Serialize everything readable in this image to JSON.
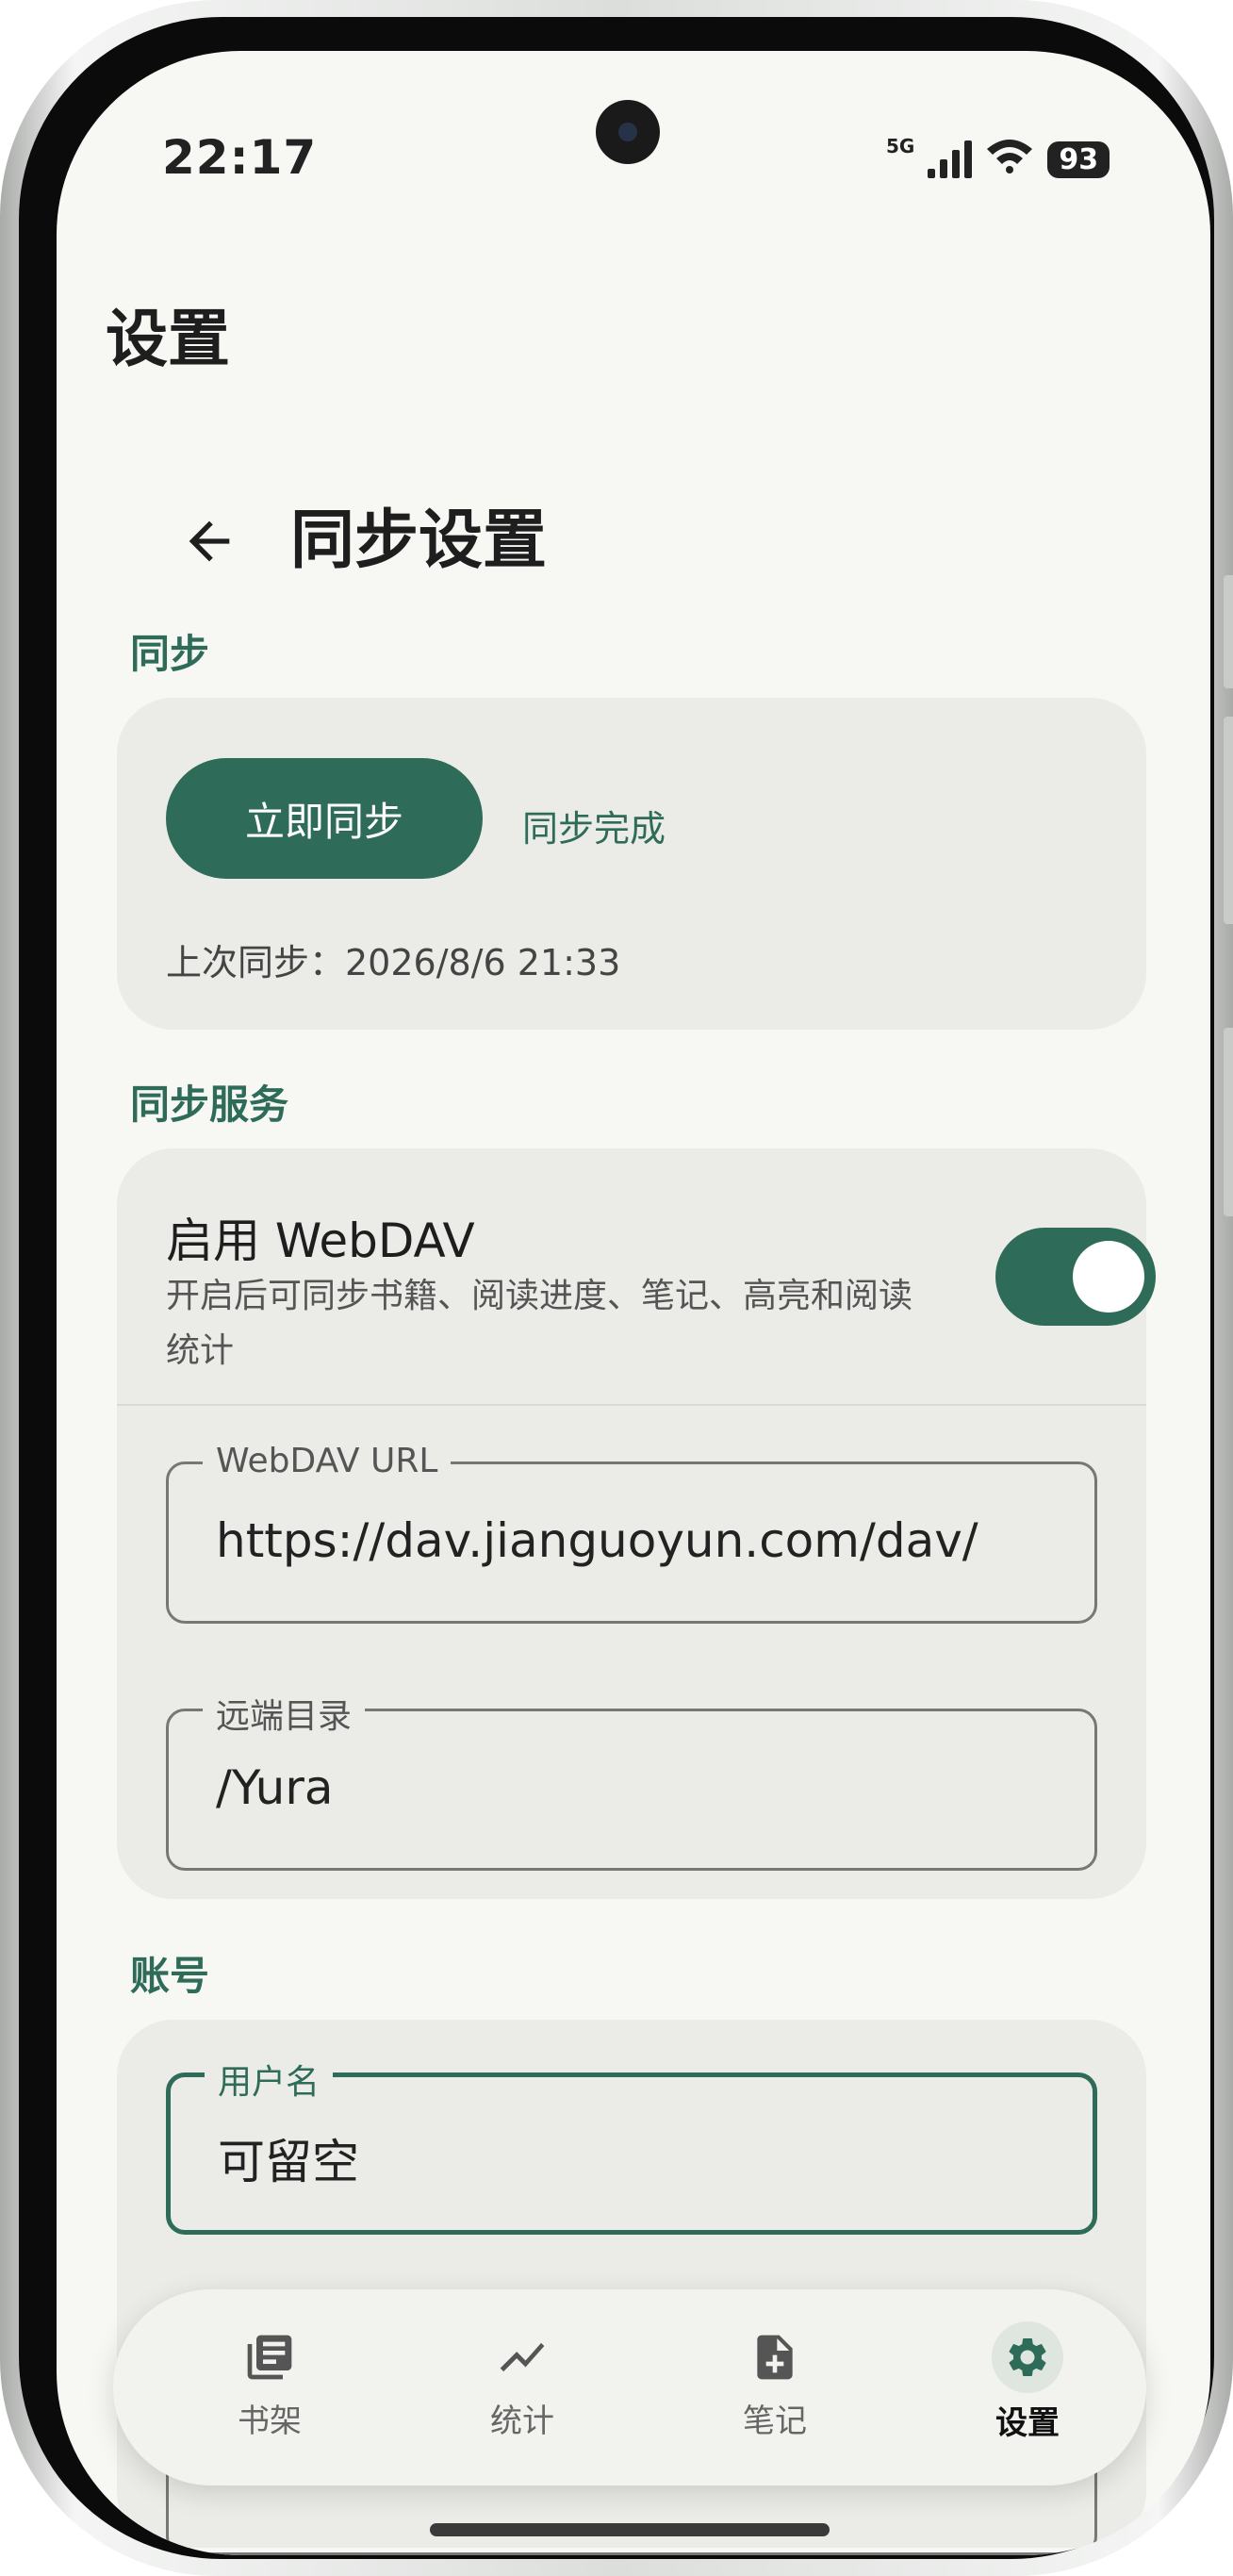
{
  "status_bar": {
    "time": "22:17",
    "network": "5G",
    "battery": "93"
  },
  "app_title": "设置",
  "page_title": "同步设置",
  "colors": {
    "accent": "#2e6b58",
    "background": "#f7f7f3",
    "card": "#ebece7"
  },
  "sections": {
    "sync": {
      "label": "同步",
      "button_label": "立即同步",
      "status": "同步完成",
      "last_sync": "上次同步：2026/8/6 21:33"
    },
    "service": {
      "label": "同步服务",
      "toggle_title": "启用 WebDAV",
      "toggle_desc": "开启后可同步书籍、阅读进度、笔记、高亮和阅读统计",
      "toggle_on": true,
      "url_label": "WebDAV URL",
      "url_value": "https://dav.jianguoyun.com/dav/",
      "dir_label": "远端目录",
      "dir_value": "/Yura"
    },
    "account": {
      "label": "账号",
      "username_label": "用户名",
      "username_placeholder": "可留空"
    }
  },
  "nav": {
    "items": [
      {
        "label": "书架",
        "icon": "library-icon"
      },
      {
        "label": "统计",
        "icon": "chart-icon"
      },
      {
        "label": "笔记",
        "icon": "note-add-icon"
      },
      {
        "label": "设置",
        "icon": "gear-icon",
        "active": true
      }
    ]
  }
}
